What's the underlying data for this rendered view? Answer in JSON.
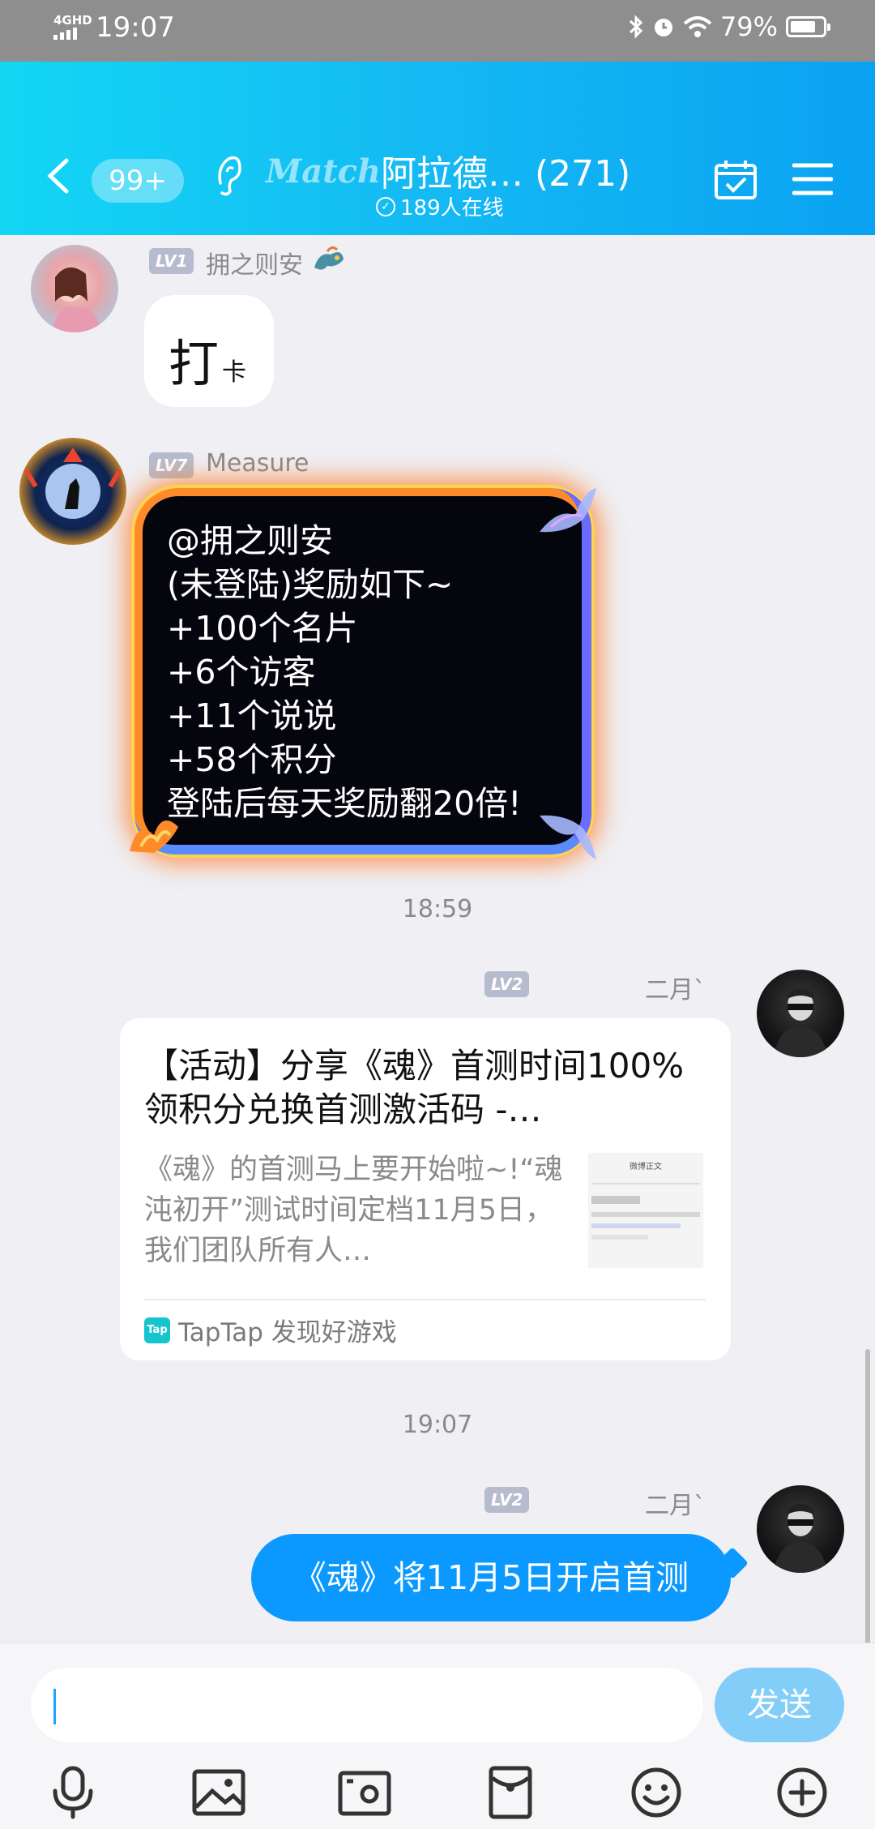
{
  "status_bar": {
    "network": "4GHD",
    "time": "19:07",
    "battery_percent": "79%",
    "battery_level": 0.79
  },
  "header": {
    "unread_badge": "99+",
    "match_logo": "Match",
    "group_name": "阿拉德… (271)",
    "online_count": "189人在线"
  },
  "messages": [
    {
      "level": "LV1",
      "nickname": "拥之则安",
      "text_big": "打",
      "text_small": "卡"
    },
    {
      "level": "LV7",
      "nickname": "Measure",
      "lines": [
        "@拥之则安",
        "(未登陆)奖励如下~",
        "+100个名片",
        "+6个访客",
        "+11个说说",
        "+58个积分",
        "登陆后每天奖励翻20倍!"
      ]
    },
    {
      "time": "18:59"
    },
    {
      "level": "LV2",
      "nickname": "二月`",
      "card": {
        "title": "【活动】分享《魂》首测时间100%领积分兑换首测激活码 -…",
        "description": "《魂》的首测马上要开始啦~!“魂沌初开”测试时间定档11月5日，我们团队所有人…",
        "source": "TapTap 发现好游戏",
        "source_logo": "Tap",
        "thumb_title": "微博正文"
      }
    },
    {
      "time": "19:07"
    },
    {
      "level": "LV2",
      "nickname": "二月`",
      "text": "《魂》将11月5日开启首测"
    }
  ],
  "input": {
    "placeholder": "",
    "send_label": "发送"
  },
  "toolbar_icons": [
    "microphone-icon",
    "image-icon",
    "camera-icon",
    "red-packet-icon",
    "emoji-icon",
    "plus-icon"
  ],
  "colors": {
    "header_start": "#13d6f4",
    "header_end": "#0aa2f2",
    "my_bubble": "#0b99ff",
    "send_button": "#83cdf9",
    "level_badge": "#b6bccd"
  }
}
